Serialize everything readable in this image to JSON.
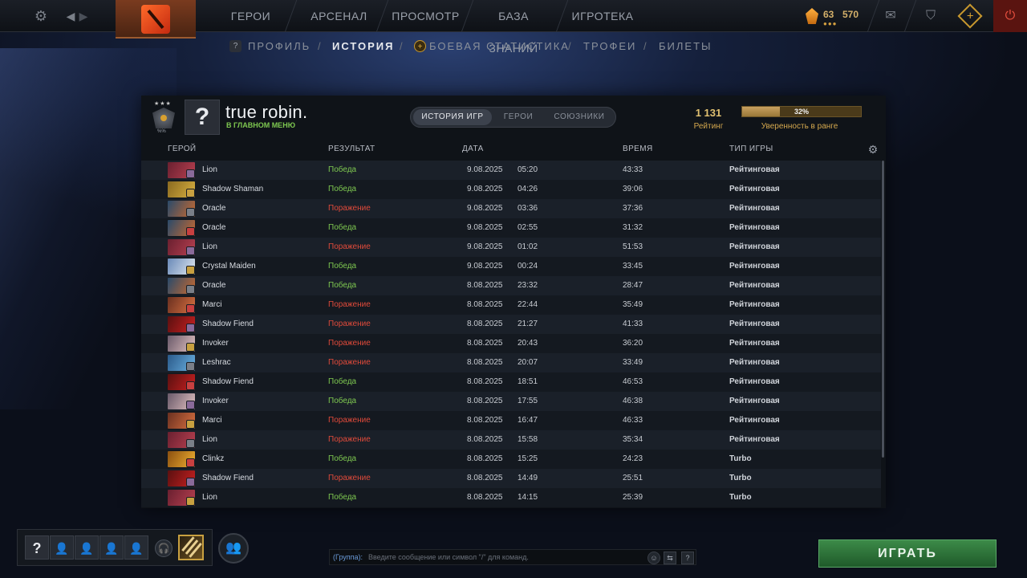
{
  "nav": {
    "items": [
      "ГЕРОИ",
      "АРСЕНАЛ",
      "ПРОСМОТР",
      "БАЗА ЗНАНИЙ",
      "ИГРОТЕКА"
    ],
    "currency_a": "63",
    "currency_b": "570"
  },
  "subnav": {
    "profile_badge": "?",
    "profile": "ПРОФИЛЬ",
    "history": "ИСТОРИЯ",
    "stats": "БОЕВАЯ СТАТИСТИКА",
    "trophies": "ТРОФЕИ",
    "tickets": "БИЛЕТЫ",
    "slash": "/"
  },
  "profile": {
    "medal_rank": "%%",
    "avatar": "?",
    "name": "true robin.",
    "status": "В ГЛАВНОМ МЕНЮ"
  },
  "tabs": [
    "ИСТОРИЯ ИГР",
    "ГЕРОИ",
    "СОЮЗНИКИ"
  ],
  "rating": {
    "value": "1 131",
    "label": "Рейтинг",
    "confidence_text": "32%",
    "confidence_value": 32,
    "confidence_label": "Уверенность в ранге"
  },
  "columns": {
    "hero": "ГЕРОЙ",
    "result": "РЕЗУЛЬТАТ",
    "date": "ДАТА",
    "duration": "ВРЕМЯ",
    "type": "ТИП ИГРЫ"
  },
  "colors": {
    "win": "#7ec850",
    "loss": "#e04a3a",
    "play_button": "#2f7a3c"
  },
  "icons": {
    "settings": "gear-icon",
    "back": "back-arrow-icon",
    "forward": "forward-arrow-icon",
    "mail": "mail-icon",
    "armory": "armory-icon",
    "plus": "plus-icon",
    "power": "power-icon",
    "voice": "headset-icon",
    "friends": "friends-icon"
  },
  "matches": [
    {
      "hero": "Lion",
      "result": "Победа",
      "win": true,
      "date": "9.08.2025",
      "time": "05:20",
      "duration": "43:33",
      "type": "Рейтинговая"
    },
    {
      "hero": "Shadow Shaman",
      "result": "Победа",
      "win": true,
      "date": "9.08.2025",
      "time": "04:26",
      "duration": "39:06",
      "type": "Рейтинговая"
    },
    {
      "hero": "Oracle",
      "result": "Поражение",
      "win": false,
      "date": "9.08.2025",
      "time": "03:36",
      "duration": "37:36",
      "type": "Рейтинговая"
    },
    {
      "hero": "Oracle",
      "result": "Победа",
      "win": true,
      "date": "9.08.2025",
      "time": "02:55",
      "duration": "31:32",
      "type": "Рейтинговая"
    },
    {
      "hero": "Lion",
      "result": "Поражение",
      "win": false,
      "date": "9.08.2025",
      "time": "01:02",
      "duration": "51:53",
      "type": "Рейтинговая"
    },
    {
      "hero": "Crystal Maiden",
      "result": "Победа",
      "win": true,
      "date": "9.08.2025",
      "time": "00:24",
      "duration": "33:45",
      "type": "Рейтинговая"
    },
    {
      "hero": "Oracle",
      "result": "Победа",
      "win": true,
      "date": "8.08.2025",
      "time": "23:32",
      "duration": "28:47",
      "type": "Рейтинговая"
    },
    {
      "hero": "Marci",
      "result": "Поражение",
      "win": false,
      "date": "8.08.2025",
      "time": "22:44",
      "duration": "35:49",
      "type": "Рейтинговая"
    },
    {
      "hero": "Shadow Fiend",
      "result": "Поражение",
      "win": false,
      "date": "8.08.2025",
      "time": "21:27",
      "duration": "41:33",
      "type": "Рейтинговая"
    },
    {
      "hero": "Invoker",
      "result": "Поражение",
      "win": false,
      "date": "8.08.2025",
      "time": "20:43",
      "duration": "36:20",
      "type": "Рейтинговая"
    },
    {
      "hero": "Leshrac",
      "result": "Поражение",
      "win": false,
      "date": "8.08.2025",
      "time": "20:07",
      "duration": "33:49",
      "type": "Рейтинговая"
    },
    {
      "hero": "Shadow Fiend",
      "result": "Победа",
      "win": true,
      "date": "8.08.2025",
      "time": "18:51",
      "duration": "46:53",
      "type": "Рейтинговая"
    },
    {
      "hero": "Invoker",
      "result": "Победа",
      "win": true,
      "date": "8.08.2025",
      "time": "17:55",
      "duration": "46:38",
      "type": "Рейтинговая"
    },
    {
      "hero": "Marci",
      "result": "Поражение",
      "win": false,
      "date": "8.08.2025",
      "time": "16:47",
      "duration": "46:33",
      "type": "Рейтинговая"
    },
    {
      "hero": "Lion",
      "result": "Поражение",
      "win": false,
      "date": "8.08.2025",
      "time": "15:58",
      "duration": "35:34",
      "type": "Рейтинговая"
    },
    {
      "hero": "Clinkz",
      "result": "Победа",
      "win": true,
      "date": "8.08.2025",
      "time": "15:25",
      "duration": "24:23",
      "type": "Turbo"
    },
    {
      "hero": "Shadow Fiend",
      "result": "Поражение",
      "win": false,
      "date": "8.08.2025",
      "time": "14:49",
      "duration": "25:51",
      "type": "Turbo"
    },
    {
      "hero": "Lion",
      "result": "Победа",
      "win": true,
      "date": "8.08.2025",
      "time": "14:15",
      "duration": "25:39",
      "type": "Turbo"
    }
  ],
  "party": {
    "me": "?"
  },
  "chat": {
    "channel": "(Группа):",
    "placeholder": "Введите сообщение или символ \"/\" для команд.",
    "help": "?"
  },
  "play_label": "ИГРАТЬ"
}
